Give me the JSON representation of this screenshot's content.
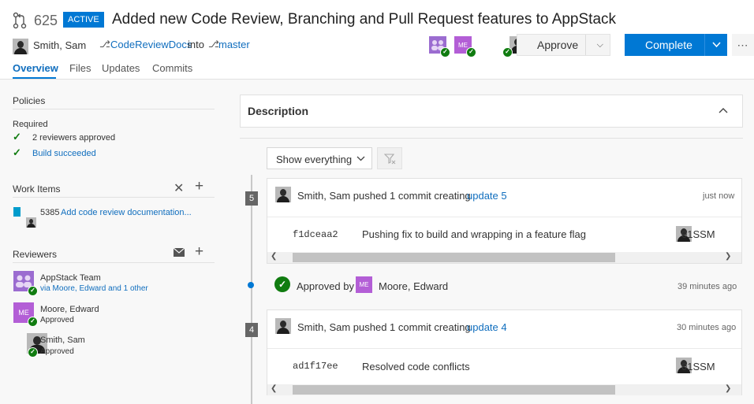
{
  "pr": {
    "number": "625",
    "status": "ACTIVE",
    "title": "Added new Code Review, Branching and Pull Request features to AppStack",
    "author": "Smith, Sam",
    "source_branch": "CodeReviewDocs",
    "into_label": "into",
    "target_branch": "master"
  },
  "actions": {
    "approve_label": "Approve",
    "complete_label": "Complete",
    "reviewer_initials": "ME"
  },
  "tabs": [
    "Overview",
    "Files",
    "Updates",
    "Commits"
  ],
  "policies": {
    "title": "Policies",
    "required_label": "Required",
    "items": [
      "2 reviewers approved",
      "Build succeeded"
    ]
  },
  "work_items": {
    "title": "Work Items",
    "id": "5385",
    "label": "Add code review documentation..."
  },
  "reviewers": {
    "title": "Reviewers",
    "list": [
      {
        "name": "AppStack Team",
        "sub": "via Moore, Edward and 1 other",
        "initials": ""
      },
      {
        "name": "Moore, Edward",
        "sub": "Approved",
        "initials": "ME"
      },
      {
        "name": "Smith, Sam",
        "sub": "Approved",
        "initials": ""
      }
    ]
  },
  "description": {
    "title": "Description"
  },
  "filter": {
    "selected": "Show everything"
  },
  "timeline": {
    "update5": {
      "badge": "5",
      "text": "Smith, Sam pushed 1 commit creating",
      "link": "update 5",
      "time": "just now",
      "commit": "f1dceaa2",
      "message": "Pushing fix to build and wrapping in a feature flag",
      "user": "01SSM"
    },
    "approval": {
      "text": "Approved by",
      "initials": "ME",
      "name": "Moore, Edward",
      "time": "39 minutes ago"
    },
    "update4": {
      "badge": "4",
      "text": "Smith, Sam pushed 1 commit creating",
      "link": "update 4",
      "time": "30 minutes ago",
      "commit": "ad1f17ee",
      "message": "Resolved code conflicts",
      "user": "01SSM"
    }
  },
  "colors": {
    "accent": "#0078d4",
    "approved": "#107c10",
    "me_avatar": "#b35ed6"
  }
}
